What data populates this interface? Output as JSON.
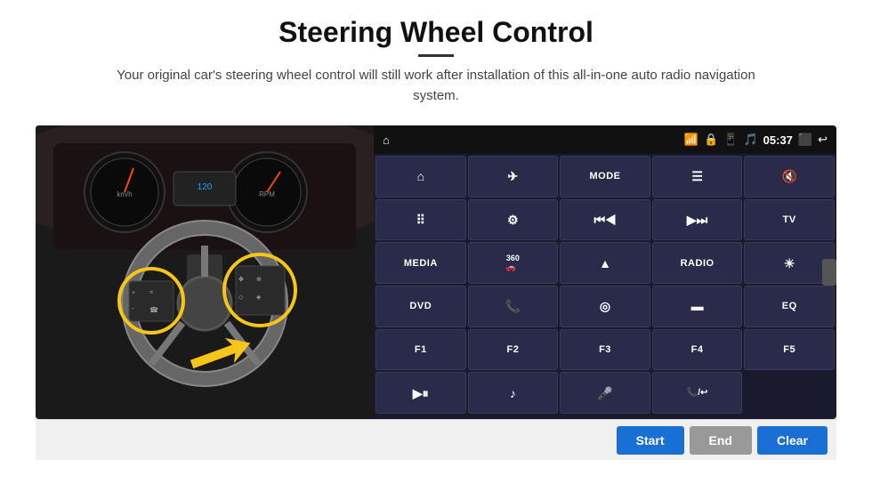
{
  "page": {
    "title": "Steering Wheel Control",
    "subtitle": "Your original car's steering wheel control will still work after installation of this all-in-one auto radio navigation system.",
    "divider_text": "—"
  },
  "status_bar": {
    "time": "05:37",
    "icons": [
      "wifi",
      "lock",
      "sim",
      "bluetooth",
      "battery",
      "screen",
      "back"
    ]
  },
  "button_grid": [
    {
      "id": "r1c1",
      "type": "icon",
      "icon": "⌂",
      "label": "home"
    },
    {
      "id": "r1c2",
      "type": "icon",
      "icon": "✈",
      "label": "navigate"
    },
    {
      "id": "r1c3",
      "type": "text",
      "text": "MODE"
    },
    {
      "id": "r1c4",
      "type": "icon",
      "icon": "≡",
      "label": "menu"
    },
    {
      "id": "r1c5",
      "type": "icon",
      "icon": "🔇",
      "label": "mute"
    },
    {
      "id": "r1c6",
      "type": "icon",
      "icon": "⠿",
      "label": "apps"
    },
    {
      "id": "r2c1",
      "type": "icon",
      "icon": "⚙",
      "label": "settings"
    },
    {
      "id": "r2c2",
      "type": "icon",
      "icon": "⏮",
      "label": "prev"
    },
    {
      "id": "r2c3",
      "type": "icon",
      "icon": "⏭",
      "label": "next"
    },
    {
      "id": "r2c4",
      "type": "text",
      "text": "TV"
    },
    {
      "id": "r2c5",
      "type": "text",
      "text": "MEDIA"
    },
    {
      "id": "r3c1",
      "type": "icon",
      "icon": "360",
      "label": "360cam"
    },
    {
      "id": "r3c2",
      "type": "icon",
      "icon": "▲",
      "label": "eject"
    },
    {
      "id": "r3c3",
      "type": "text",
      "text": "RADIO"
    },
    {
      "id": "r3c4",
      "type": "icon",
      "icon": "☀",
      "label": "brightness"
    },
    {
      "id": "r3c5",
      "type": "text",
      "text": "DVD"
    },
    {
      "id": "r4c1",
      "type": "icon",
      "icon": "📞",
      "label": "call"
    },
    {
      "id": "r4c2",
      "type": "icon",
      "icon": "◎",
      "label": "compass"
    },
    {
      "id": "r4c3",
      "type": "icon",
      "icon": "▬",
      "label": "screen"
    },
    {
      "id": "r4c4",
      "type": "text",
      "text": "EQ"
    },
    {
      "id": "r4c5",
      "type": "text",
      "text": "F1"
    },
    {
      "id": "r5c1",
      "type": "text",
      "text": "F2"
    },
    {
      "id": "r5c2",
      "type": "text",
      "text": "F3"
    },
    {
      "id": "r5c3",
      "type": "text",
      "text": "F4"
    },
    {
      "id": "r5c4",
      "type": "text",
      "text": "F5"
    },
    {
      "id": "r5c5",
      "type": "icon",
      "icon": "▶⏸",
      "label": "playpause"
    },
    {
      "id": "r6c1",
      "type": "icon",
      "icon": "♪",
      "label": "music"
    },
    {
      "id": "r6c2",
      "type": "icon",
      "icon": "🎤",
      "label": "mic"
    },
    {
      "id": "r6c3",
      "type": "icon",
      "icon": "📞/↩",
      "label": "call-hangup"
    },
    {
      "id": "r6c4",
      "type": "empty",
      "text": ""
    },
    {
      "id": "r6c5",
      "type": "empty",
      "text": ""
    }
  ],
  "bottom_bar": {
    "start_label": "Start",
    "end_label": "End",
    "clear_label": "Clear"
  }
}
